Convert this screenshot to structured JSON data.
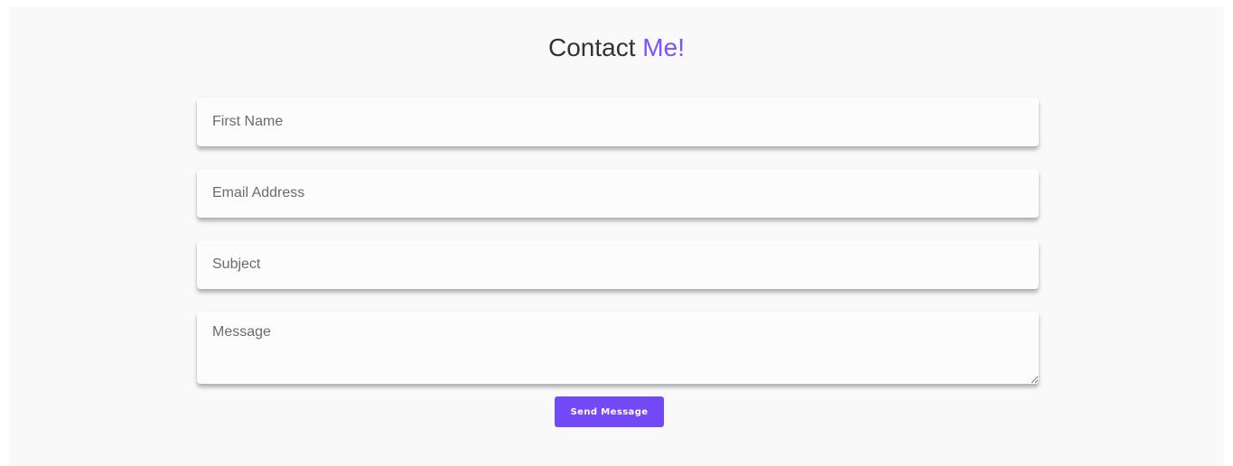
{
  "header": {
    "title_main": "Contact",
    "title_accent": "Me!"
  },
  "form": {
    "first_name_placeholder": "First Name",
    "email_placeholder": "Email Address",
    "subject_placeholder": "Subject",
    "message_placeholder": "Message",
    "submit_label": "Send Message"
  },
  "colors": {
    "accent": "#7a52ff",
    "button": "#7248f7",
    "background": "#f9f9f9"
  }
}
